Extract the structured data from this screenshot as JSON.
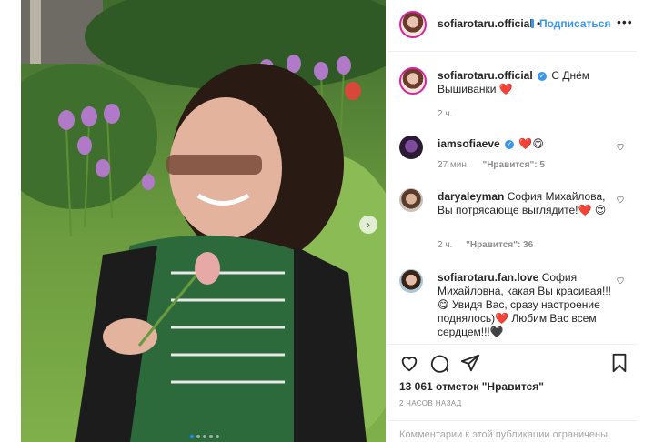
{
  "post": {
    "author": "sofiarotaru.official",
    "follow_label": "Подписаться",
    "separator": "•",
    "more_icon": "more-dots-icon",
    "caption_author": "sofiarotaru.official",
    "caption_text": "С Днём Вышиванки",
    "caption_emoji": "❤️",
    "caption_time": "2 ч.",
    "carousel": {
      "current": 1,
      "total": 5
    }
  },
  "comments": [
    {
      "user": "iamsofiaeve",
      "text": "❤️😋",
      "time": "27 мин.",
      "likes": "\"Нравится\": 5",
      "verified": true
    },
    {
      "user": "daryaleyman",
      "text": "София Михайлова, Вы потрясающе выглядите!❤️ 😍",
      "time": "2 ч.",
      "likes": "\"Нравится\": 36",
      "verified": false
    },
    {
      "user": "sofiarotaru.fan.love",
      "text": "София Михайловна, какая Вы красивая!!!😋 Увидя Вас, сразу настроение поднялось)❤️ Любим Вас всем сердцем!!!🖤",
      "time": "",
      "likes": "",
      "verified": false
    }
  ],
  "actions": {
    "likes_total": "13 061 отметок \"Нравится\"",
    "time_ago": "2 часов назад",
    "restricted": "Комментарии к этой публикации ограничены."
  },
  "icons": {
    "like": "heart-icon",
    "comment": "comment-icon",
    "share": "paper-plane-icon",
    "save": "bookmark-icon",
    "next": "chevron-right-icon"
  },
  "colors": {
    "accent": "#3897f0",
    "heart": "#e0245e",
    "muted": "#8e8e8e"
  }
}
